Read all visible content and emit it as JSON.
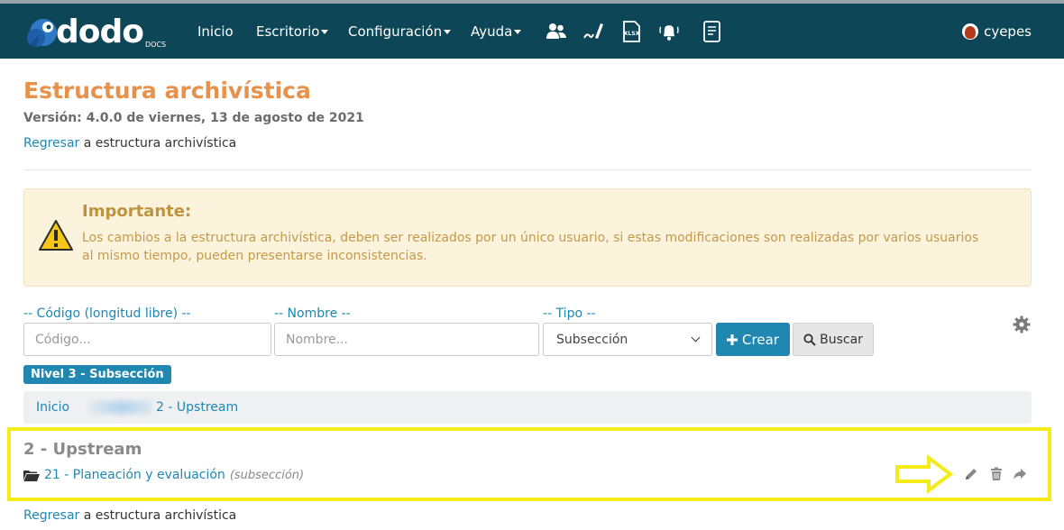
{
  "navbar": {
    "brand": "dodo",
    "brand_sub": "DOCS",
    "menu": [
      {
        "label": "Inicio",
        "has_dropdown": false
      },
      {
        "label": "Escritorio",
        "has_dropdown": true
      },
      {
        "label": "Configuración",
        "has_dropdown": true
      },
      {
        "label": "Ayuda",
        "has_dropdown": true
      }
    ],
    "icons": [
      "users-icon",
      "signature-icon",
      "xlsx-export-icon",
      "notifications-bell-icon",
      "document-list-icon"
    ],
    "user_name": "cyepes"
  },
  "header": {
    "title": "Estructura archivística",
    "version": "Versión: 4.0.0 de viernes, 13 de agosto de 2021",
    "back_link": "Regresar",
    "back_text": " a estructura archivística"
  },
  "alert": {
    "title": "Importante:",
    "message": "Los cambios a la estructura archivística, deben ser realizados por un único usuario, si estas modificaciones son realizadas por varios usuarios al mismo tiempo, pueden presentarse inconsistencias."
  },
  "filters": {
    "codigo_label": "-- Código (longitud libre) --",
    "codigo_placeholder": "Código...",
    "nombre_label": "-- Nombre --",
    "nombre_placeholder": "Nombre...",
    "tipo_label": "-- Tipo --",
    "tipo_selected": "Subsección",
    "crear_label": "Crear",
    "buscar_label": "Buscar"
  },
  "level_badge": "Nivel 3 - Subsección",
  "breadcrumb": {
    "root": "Inicio",
    "current": "2 - Upstream"
  },
  "section": {
    "title": "2 - Upstream",
    "item_label": "21 - Planeación y evaluación",
    "item_type": "(subsección)"
  },
  "footer": {
    "back_link": "Regresar",
    "back_text": " a estructura archivística"
  },
  "colors": {
    "navbar": "#0d4656",
    "title": "#e8914a",
    "link": "#1f87b0",
    "highlight": "#f3ec18"
  }
}
